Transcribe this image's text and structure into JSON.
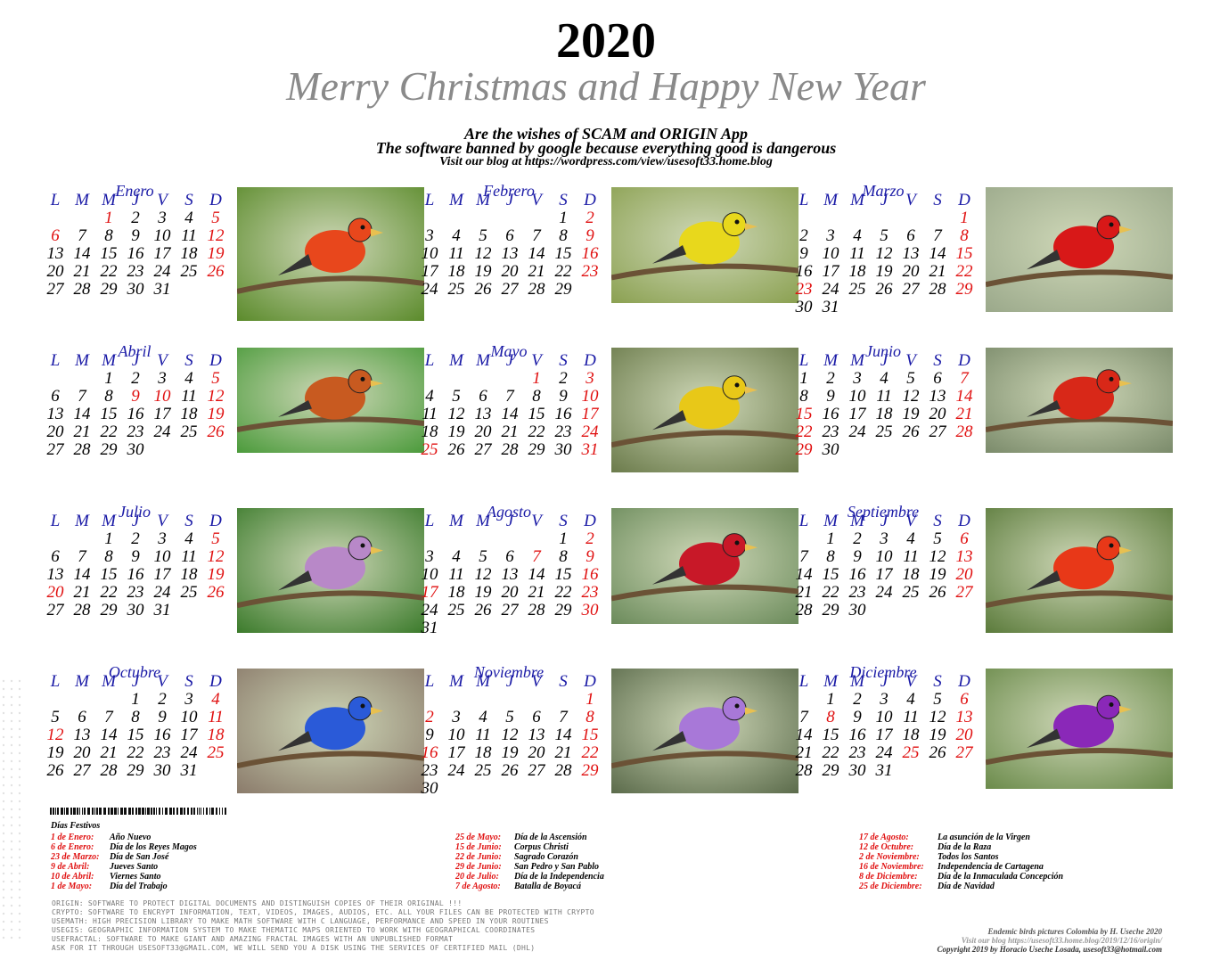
{
  "header": {
    "year": "2020",
    "greeting": "Merry Christmas and Happy New Year",
    "line1": "Are the wishes of SCAM and ORIGIN App",
    "line2": "The software banned by google because everything good is dangerous",
    "line3": "Visit our blog at https://wordpress.com/view/usesoft33.home.blog"
  },
  "weekdays": [
    "L",
    "M",
    "M",
    "J",
    "V",
    "S",
    "D"
  ],
  "colors": {
    "weekday_header": "#1a1aa6",
    "holiday": "#e01010",
    "greeting": "#8a8a8a"
  },
  "months": [
    {
      "name": "Enero",
      "offset": 2,
      "days": 31,
      "red": [
        1,
        5,
        6,
        12,
        19,
        26
      ],
      "photo": "royal-flycatcher-bird-photo",
      "bird_color": "#e8471c",
      "bg": "#5a8a2a"
    },
    {
      "name": "Febrero",
      "offset": 5,
      "days": 29,
      "red": [
        2,
        9,
        16,
        23
      ],
      "photo": "gouldian-finch-photo",
      "bird_color": "#e8d81c",
      "bg": "#8aa050"
    },
    {
      "name": "Marzo",
      "offset": 6,
      "days": 31,
      "red": [
        1,
        8,
        15,
        22,
        23,
        29
      ],
      "photo": "andean-cock-of-the-rock-photo",
      "bird_color": "#d81818",
      "bg": "#9aa88a"
    },
    {
      "name": "Abril",
      "offset": 2,
      "days": 30,
      "red": [
        5,
        9,
        10,
        12,
        19,
        26
      ],
      "photo": "hummingbird-coquette-photo",
      "bird_color": "#c85a20",
      "bg": "#4a9a3a"
    },
    {
      "name": "Mayo",
      "offset": 4,
      "days": 31,
      "red": [
        1,
        3,
        10,
        17,
        24,
        25,
        31
      ],
      "photo": "blue-winged-mountain-tanager-photo",
      "bird_color": "#e8c818",
      "bg": "#6a7a4a"
    },
    {
      "name": "Junio",
      "offset": 0,
      "days": 30,
      "red": [
        7,
        14,
        15,
        21,
        22,
        28,
        29
      ],
      "photo": "red-headed-barbet-photo",
      "bird_color": "#d82818",
      "bg": "#7a8a6a"
    },
    {
      "name": "Julio",
      "offset": 2,
      "days": 31,
      "red": [
        5,
        12,
        19,
        20,
        26
      ],
      "photo": "three-gouldian-finches-photo",
      "bird_color": "#b888c8",
      "bg": "#3a7a2a"
    },
    {
      "name": "Agosto",
      "offset": 5,
      "days": 31,
      "red": [
        2,
        7,
        9,
        16,
        17,
        23,
        30
      ],
      "photo": "crimson-backed-tanager-photo",
      "bird_color": "#c81828",
      "bg": "#6a8a5a"
    },
    {
      "name": "Septiembre",
      "offset": 1,
      "days": 30,
      "red": [
        6,
        13,
        20,
        27
      ],
      "photo": "eastern-rosella-parrot-photo",
      "bird_color": "#e83818",
      "bg": "#5a7a3a"
    },
    {
      "name": "Octubre",
      "offset": 3,
      "days": 31,
      "red": [
        4,
        11,
        12,
        18,
        25
      ],
      "photo": "mountain-bluebird-photo",
      "bird_color": "#2a5ad8",
      "bg": "#8a7a6a"
    },
    {
      "name": "Noviembre",
      "offset": 6,
      "days": 30,
      "red": [
        1,
        2,
        8,
        15,
        16,
        22,
        29
      ],
      "photo": "purple-bird-in-flight-photo",
      "bird_color": "#a878d8",
      "bg": "#5a6a4a"
    },
    {
      "name": "Diciembre",
      "offset": 1,
      "days": 31,
      "red": [
        6,
        8,
        13,
        20,
        25,
        27
      ],
      "photo": "violet-backed-starling-photo",
      "bird_color": "#8a28b8",
      "bg": "#6a8a4a"
    }
  ],
  "festivos": {
    "title": "Días Festivos",
    "col1": [
      {
        "date": "1 de Enero:",
        "name": "Año Nuevo"
      },
      {
        "date": "6 de Enero:",
        "name": "Día de los Reyes Magos"
      },
      {
        "date": "23 de Marzo:",
        "name": "Día de San José"
      },
      {
        "date": "9 de Abril:",
        "name": "Jueves Santo"
      },
      {
        "date": "10 de Abril:",
        "name": "Viernes Santo"
      },
      {
        "date": "1 de Mayo:",
        "name": "Día del Trabajo"
      }
    ],
    "col2": [
      {
        "date": "25 de Mayo:",
        "name": "Día de la Ascensión"
      },
      {
        "date": "15 de Junio:",
        "name": "Corpus Christi"
      },
      {
        "date": "22 de Junio:",
        "name": "Sagrado Corazón"
      },
      {
        "date": "29 de Junio:",
        "name": "San Pedro y San Pablo"
      },
      {
        "date": "20 de Julio:",
        "name": "Día de la Independencia"
      },
      {
        "date": "7 de Agosto:",
        "name": "Batalla de Boyacá"
      }
    ],
    "col3": [
      {
        "date": "17 de Agosto:",
        "name": "La asunción de la Virgen"
      },
      {
        "date": "12 de Octubre:",
        "name": "Día de la Raza"
      },
      {
        "date": "2 de Noviembre:",
        "name": "Todos los Santos"
      },
      {
        "date": "16 de Noviembre:",
        "name": "Independencia de Cartagena"
      },
      {
        "date": "8 de Diciembre:",
        "name": "Día de la Inmaculada Concepción"
      },
      {
        "date": "25 de Diciembre:",
        "name": "Día de Navidad"
      }
    ]
  },
  "software": [
    "ORIGIN: SOFTWARE TO PROTECT DIGITAL DOCUMENTS AND DISTINGUISH COPIES OF THEIR ORIGINAL !!!",
    "CRYPTO: SOFTWARE TO ENCRYPT INFORMATION, TEXT, VIDEOS, IMAGES, AUDIOS, ETC. ALL YOUR FILES CAN BE PROTECTED WITH CRYPTO",
    "USEMATH: HIGH PRECISION LIBRARY TO MAKE MATH SOFTWARE WITH C LANGUAGE, PERFORMANCE AND SPEED IN YOUR ROUTINES",
    "USEGIS: GEOGRAPHIC INFORMATION SYSTEM TO MAKE THEMATIC MAPS ORIENTED TO WORK WITH GEOGRAPHICAL COORDINATES",
    "USEFRACTAL: SOFTWARE TO MAKE GIANT AND AMAZING FRACTAL IMAGES WITH AN UNPUBLISHED FORMAT",
    "ASK FOR IT THROUGH USESOFT33@GMAIL.COM, WE WILL SEND YOU A DISK USING THE SERVICES OF CERTIFIED MAIL (DHL)"
  ],
  "credits": {
    "line1": "Endemic birds pictures Colombia by H. Useche 2020",
    "line2": "Visit our blog https://usesoft33.home.blog/2019/12/16/origin/",
    "line3": "Copyright 2019 by Horacio Useche Losada, usesoft33@hotmail.com"
  }
}
